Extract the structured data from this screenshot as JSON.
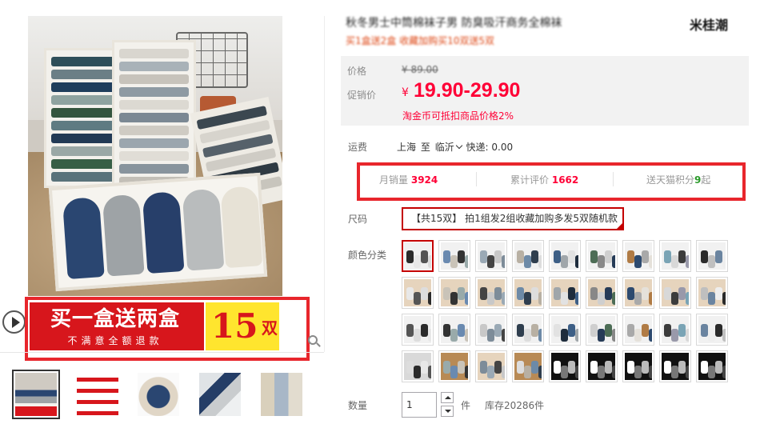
{
  "product": {
    "title_blurred": "秋冬男士中筒棉袜子男 防臭吸汗商务全棉袜",
    "brand_blurred": "米桂潮",
    "subtitle_blurred": "买1盒送2盒 收藏加购买10双送5双"
  },
  "gallery": {
    "promo_main": "买一盒送两盒",
    "promo_sub": "不满意全额退款",
    "promo_number": "15",
    "promo_unit": "双",
    "thumbnails": [
      {
        "name": "thumb-1",
        "active": true
      },
      {
        "name": "thumb-2",
        "active": false
      },
      {
        "name": "thumb-3",
        "active": false
      },
      {
        "name": "thumb-4",
        "active": false
      },
      {
        "name": "thumb-5",
        "active": false
      }
    ]
  },
  "price": {
    "orig_label": "价格",
    "orig_value": "¥ 89.00",
    "promo_label": "促销价",
    "currency": "¥",
    "promo_value": "19.90-29.90",
    "coin_note": "淘金币可抵扣商品价格2%"
  },
  "shipping": {
    "label": "运费",
    "from": "上海",
    "to_word": "至",
    "to": "临沂",
    "express": "快递: 0.00"
  },
  "stats": {
    "monthly_label": "月销量",
    "monthly_value": "3924",
    "reviews_label": "累计评价",
    "reviews_value": "1662",
    "points_label": "送天猫积分",
    "points_value": "9",
    "points_suffix": "起"
  },
  "size": {
    "label": "尺码",
    "option": "【共15双】 拍1组发2组收藏加购多发5双随机款"
  },
  "color": {
    "label": "颜色分类",
    "swatch_count": 36
  },
  "quantity": {
    "label": "数量",
    "value": "1",
    "unit": "件",
    "stock": "库存20286件"
  },
  "colors": {
    "accent_red": "#ff0036",
    "highlight_red": "#e8262c",
    "promo_yellow": "#ffe52e"
  }
}
